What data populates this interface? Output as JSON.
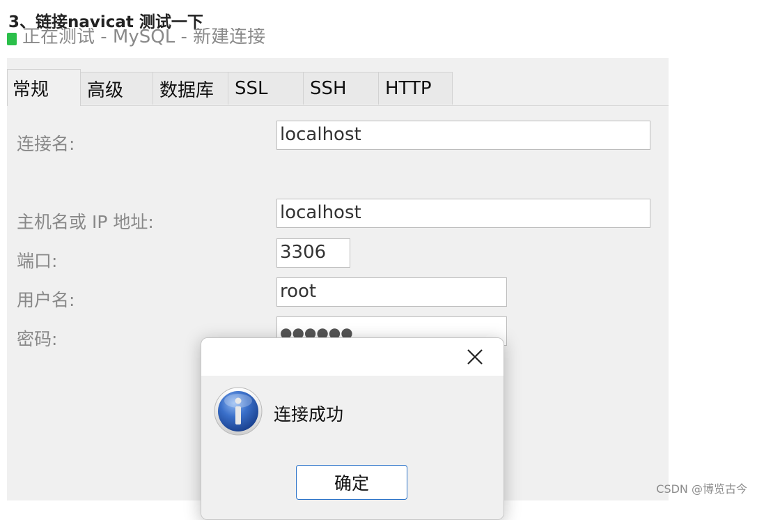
{
  "heading": "3、链接navicat 测试一下",
  "window_title": "正在测试 - MySQL - 新建连接",
  "tabs": [
    "常规",
    "高级",
    "数据库",
    "SSL",
    "SSH",
    "HTTP"
  ],
  "form": {
    "connection_name_label": "连接名:",
    "connection_name_value": "localhost",
    "host_label": "主机名或 IP 地址:",
    "host_value": "localhost",
    "port_label": "端口:",
    "port_value": "3306",
    "username_label": "用户名:",
    "username_value": "root",
    "password_label": "密码:",
    "password_value": "●●●●●●"
  },
  "dialog": {
    "message": "连接成功",
    "ok_label": "确定",
    "icon": "info-icon",
    "close_icon": "close-icon"
  },
  "watermark": "CSDN @博览古今",
  "colors": {
    "accent": "#2a72c8",
    "app_icon": "#2bbf4a"
  }
}
